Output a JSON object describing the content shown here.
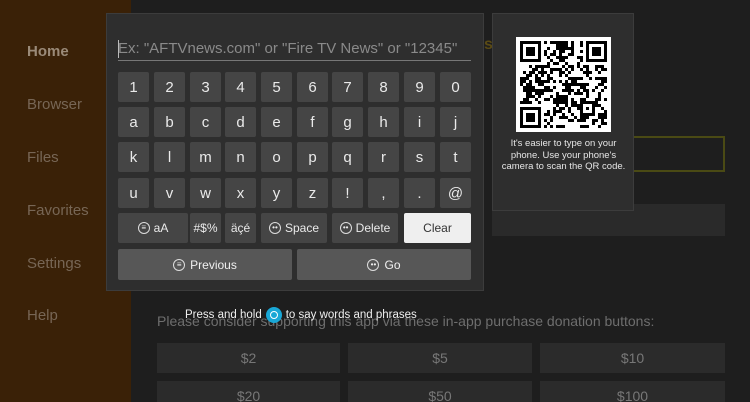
{
  "sidebar": {
    "items": [
      {
        "label": "Home"
      },
      {
        "label": "Browser"
      },
      {
        "label": "Files"
      },
      {
        "label": "Favorites"
      },
      {
        "label": "Settings"
      },
      {
        "label": "Help"
      }
    ]
  },
  "background": {
    "donation_text": "Please consider supporting this app via these in-app purchase donation buttons:",
    "donations_row1": [
      "$2",
      "$5",
      "$10"
    ],
    "donations_row2": [
      "$20",
      "$50",
      "$100"
    ]
  },
  "search": {
    "placeholder": "Ex: \"AFTVnews.com\" or \"Fire TV News\" or \"12345\""
  },
  "keyboard": {
    "rows": [
      [
        "1",
        "2",
        "3",
        "4",
        "5",
        "6",
        "7",
        "8",
        "9",
        "0"
      ],
      [
        "a",
        "b",
        "c",
        "d",
        "e",
        "f",
        "g",
        "h",
        "i",
        "j"
      ],
      [
        "k",
        "l",
        "m",
        "n",
        "o",
        "p",
        "q",
        "r",
        "s",
        "t"
      ],
      [
        "u",
        "v",
        "w",
        "x",
        "y",
        "z",
        "!",
        ",",
        ".",
        "@"
      ]
    ],
    "case_key": "aA",
    "symbols_key": "#$%",
    "accents_key": "äçé",
    "space_label": "Space",
    "delete_label": "Delete",
    "clear_label": "Clear",
    "previous_label": "Previous",
    "go_label": "Go"
  },
  "qr": {
    "text": "It's easier to type on your phone. Use your phone's camera to scan the QR code."
  },
  "hint": {
    "before": "Press and hold",
    "after": "to say words and phrases"
  },
  "colors": {
    "clear_key_bg": "#efefef",
    "alexa_blue": "#19a7d6",
    "sidebar_bg": "#3a2107"
  }
}
